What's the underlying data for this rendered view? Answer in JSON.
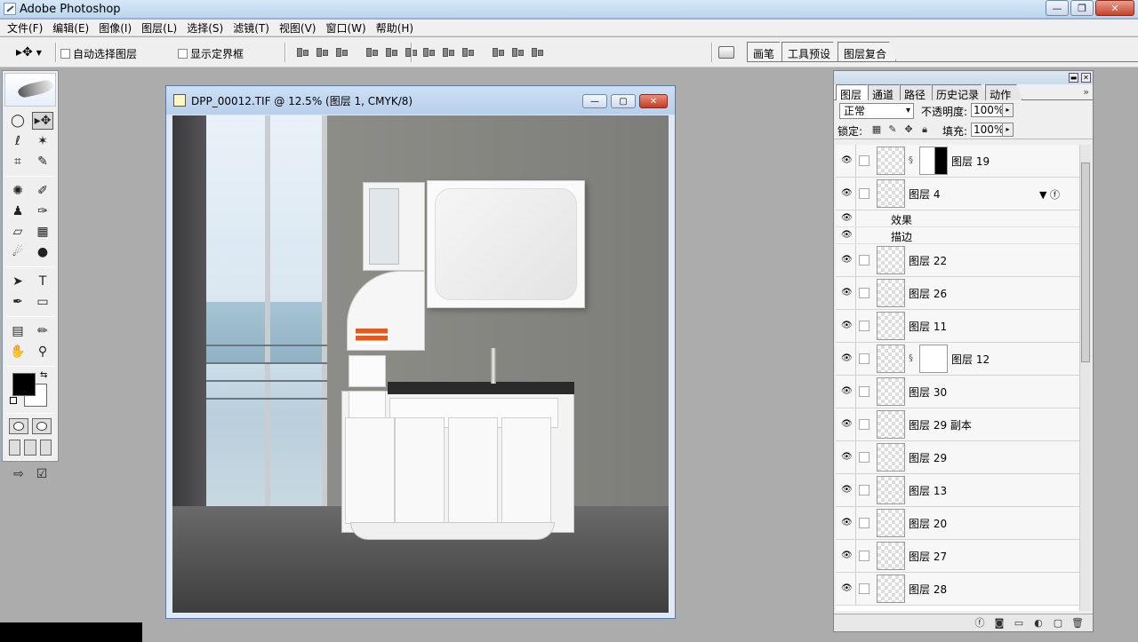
{
  "app": {
    "title": "Adobe Photoshop"
  },
  "menu": [
    "文件(F)",
    "编辑(E)",
    "图像(I)",
    "图层(L)",
    "选择(S)",
    "滤镜(T)",
    "视图(V)",
    "窗口(W)",
    "帮助(H)"
  ],
  "options": {
    "auto_select_label": "自动选择图层",
    "show_bounds_label": "显示定界框",
    "well_tabs": [
      "画笔",
      "工具预设",
      "图层复合"
    ]
  },
  "document": {
    "title": "DPP_00012.TIF @ 12.5% (图层 1, CMYK/8)"
  },
  "layers_panel": {
    "tabs": [
      "图层",
      "通道",
      "路径",
      "历史记录",
      "动作"
    ],
    "blend_mode": "正常",
    "opacity_label": "不透明度:",
    "opacity": "100%",
    "lock_label": "锁定:",
    "fill_label": "填充:",
    "fill": "100%",
    "layers": [
      {
        "name": "图层 19",
        "mask": true
      },
      {
        "name": "图层 4",
        "fx": true
      },
      {
        "name": "图层 22"
      },
      {
        "name": "图层 26"
      },
      {
        "name": "图层 11"
      },
      {
        "name": "图层 12",
        "mask": true
      },
      {
        "name": "图层 30"
      },
      {
        "name": "图层 29 副本"
      },
      {
        "name": "图层 29"
      },
      {
        "name": "图层 13"
      },
      {
        "name": "图层 20"
      },
      {
        "name": "图层 27"
      },
      {
        "name": "图层 28"
      }
    ],
    "effects_label": "效果",
    "stroke_label": "描边"
  },
  "colors": {
    "foreground": "#000000",
    "background": "#ffffff"
  }
}
